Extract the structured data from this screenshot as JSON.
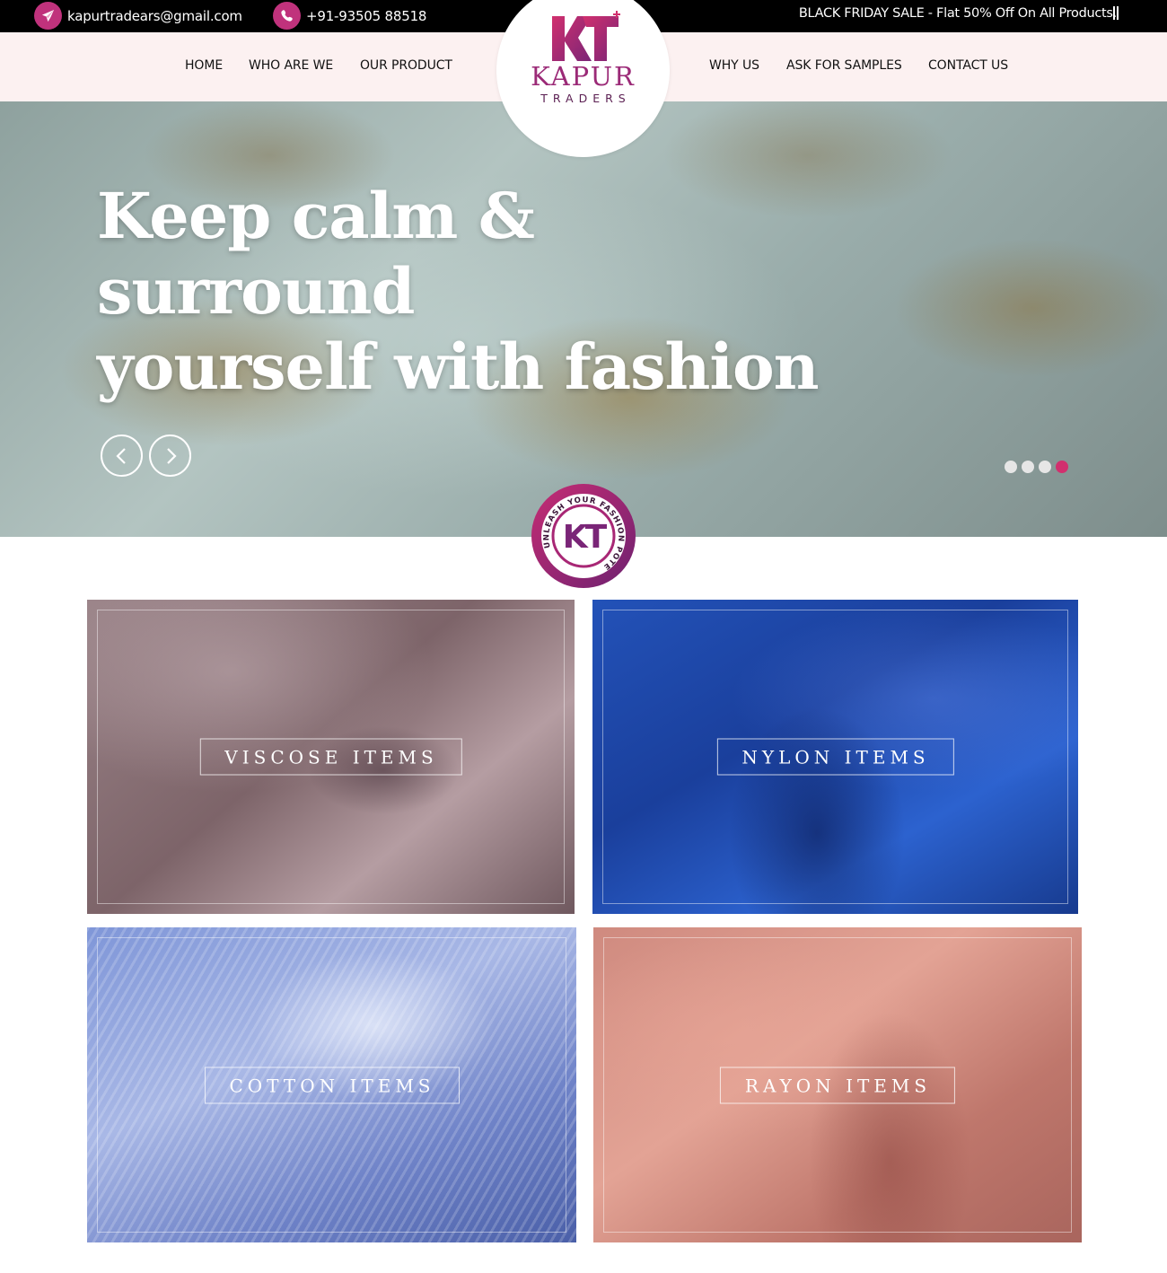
{
  "topbar": {
    "email": "kapurtradears@gmail.com",
    "phone": "+91-93505 88518",
    "promo": "BLACK FRIDAY SALE - Flat 50% Off On All Products."
  },
  "nav": {
    "left": [
      "HOME",
      "WHO ARE WE",
      "OUR PRODUCT"
    ],
    "right": [
      "WHY US",
      "ASK FOR SAMPLES",
      "CONTACT US"
    ]
  },
  "logo": {
    "mark": "KT",
    "name": "KAPUR",
    "sub": "TRADERS"
  },
  "hero": {
    "line1": "Keep calm & surround",
    "line2": "yourself with fashion",
    "slide_count": 4,
    "active_slide": 4
  },
  "badge": {
    "text": "UNLEASH YOUR FASHION POTENTIAL",
    "mark": "KT"
  },
  "categories": [
    "VISCOSE ITEMS",
    "NYLON ITEMS",
    "COTTON ITEMS",
    "RAYON ITEMS"
  ],
  "colors": {
    "accent": "#c0327c",
    "brand": "#9b2a77",
    "topbar": "#000000",
    "navbar": "#fcf1f1",
    "dot_active": "#d1306e",
    "dot_inactive": "#e6e6e6"
  },
  "icons": {
    "email": "paper-plane-icon",
    "phone": "phone-icon",
    "prev": "chevron-left-icon",
    "next": "chevron-right-icon"
  }
}
